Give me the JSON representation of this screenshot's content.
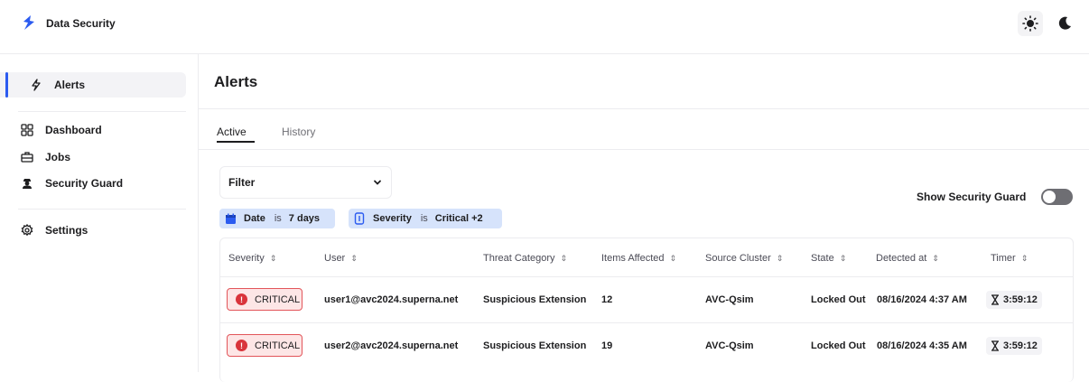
{
  "app": {
    "title": "Data Security",
    "accent": "#2b5bf0",
    "logo_icon": "superna-logo"
  },
  "theme": {
    "light_icon": "sun-icon",
    "dark_icon": "moon-icon"
  },
  "sidebar": {
    "items": [
      {
        "label": "Alerts",
        "icon": "lightning-icon",
        "active": true
      },
      {
        "label": "Dashboard",
        "icon": "grid-icon"
      },
      {
        "label": "Jobs",
        "icon": "briefcase-icon"
      },
      {
        "label": "Security Guard",
        "icon": "agent-icon"
      },
      {
        "label": "Settings",
        "icon": "gear-icon"
      }
    ]
  },
  "page": {
    "title": "Alerts"
  },
  "tabs": [
    {
      "label": "Active",
      "active": true
    },
    {
      "label": "History",
      "active": false
    }
  ],
  "filter": {
    "label": "Filter"
  },
  "chips": [
    {
      "field": "Date",
      "op": "is",
      "value": "7 days",
      "icon": "calendar-icon"
    },
    {
      "field": "Severity",
      "op": "is",
      "value": "Critical +2",
      "icon": "shield-icon"
    }
  ],
  "security_guard_toggle": {
    "label": "Show Security Guard",
    "on": false
  },
  "table": {
    "columns": [
      "Severity",
      "User",
      "Threat Category",
      "Items Affected",
      "Source Cluster",
      "State",
      "Detected at",
      "Timer"
    ],
    "rows": [
      {
        "severity": "CRITICAL",
        "user": "user1@avc2024.superna.net",
        "threat": "Suspicious Extension",
        "items": "12",
        "cluster": "AVC-Qsim",
        "state": "Locked Out",
        "detected": "08/16/2024 4:37 AM",
        "timer": "3:59:12"
      },
      {
        "severity": "CRITICAL",
        "user": "user2@avc2024.superna.net",
        "threat": "Suspicious Extension",
        "items": "19",
        "cluster": "AVC-Qsim",
        "state": "Locked Out",
        "detected": "08/16/2024 4:35 AM",
        "timer": "3:59:12"
      }
    ],
    "critical_color": "#d9343b"
  }
}
